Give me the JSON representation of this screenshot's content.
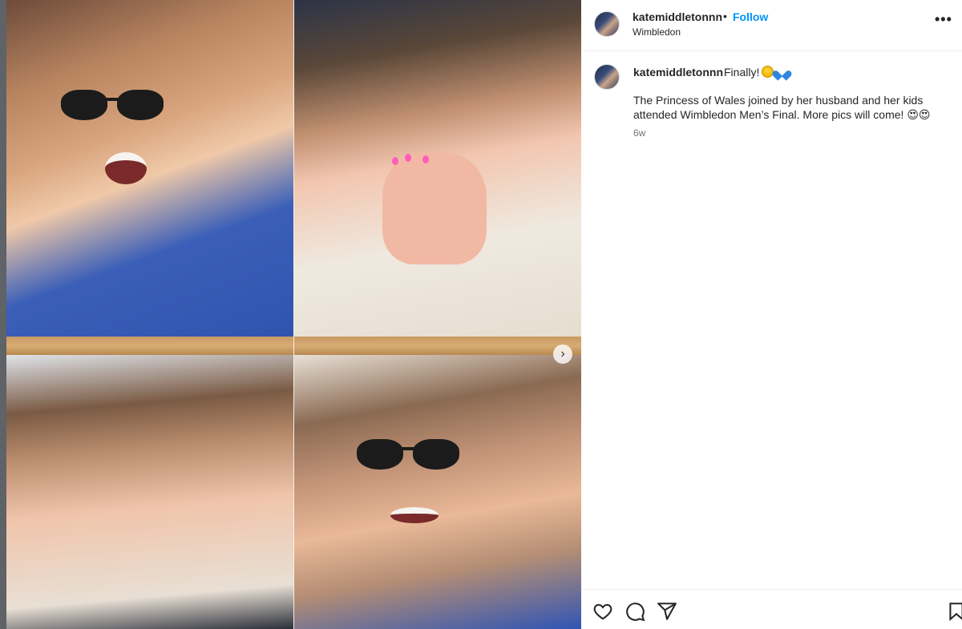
{
  "post": {
    "username": "katemiddletonnn",
    "separator": "•",
    "follow_label": "Follow",
    "location": "Wimbledon",
    "more_label": "•••"
  },
  "caption": {
    "username": "katemiddletonnn",
    "first_line": "Finally!",
    "emojis": [
      "star-struck-emoji",
      "blue-heart-emoji"
    ],
    "body": "The Princess of Wales joined by her husband and her kids attended Wimbledon Men’s Final. More pics will come! 😍😍",
    "time": "6w"
  },
  "media": {
    "next_arrow": "›"
  },
  "actions": {
    "icons": [
      "heart-icon",
      "comment-icon",
      "share-icon",
      "bookmark-icon"
    ]
  },
  "colors": {
    "follow": "#0095f6",
    "text": "#262626",
    "muted": "#737373"
  }
}
